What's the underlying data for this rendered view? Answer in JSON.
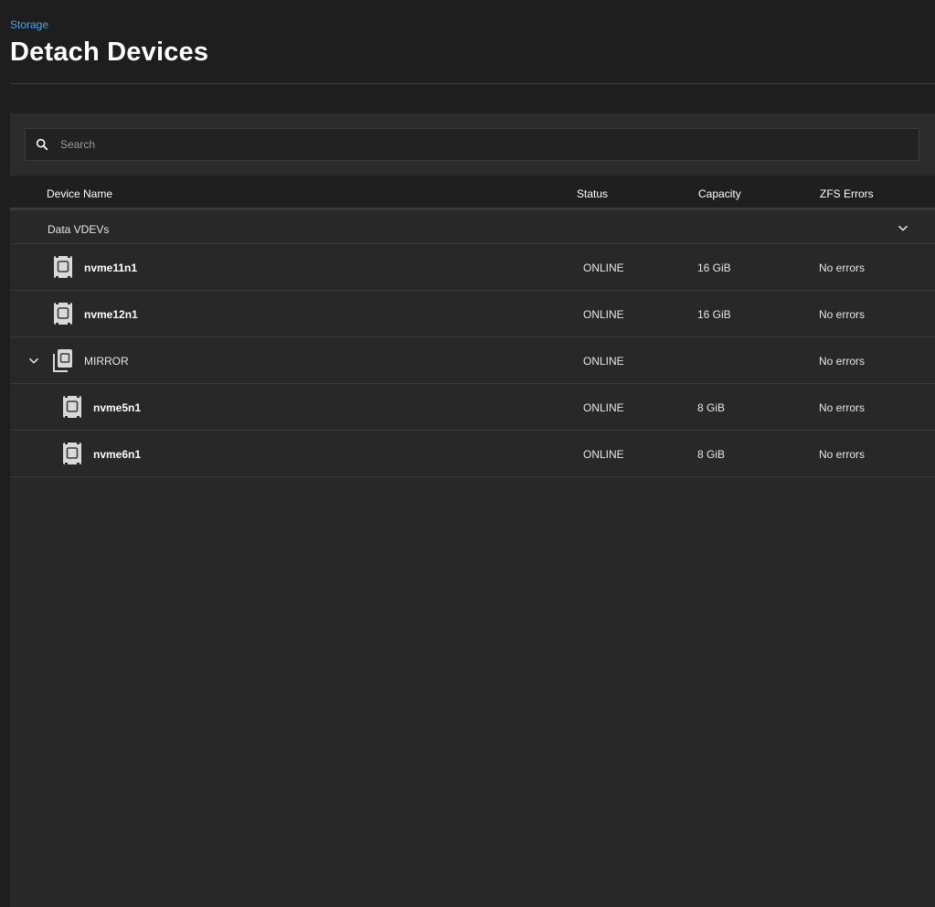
{
  "header": {
    "breadcrumb": "Storage",
    "title": "Detach Devices"
  },
  "search": {
    "placeholder": "Search",
    "value": ""
  },
  "table": {
    "columns": [
      "Device Name",
      "Status",
      "Capacity",
      "ZFS Errors"
    ],
    "group": {
      "label": "Data VDEVs",
      "expanded": true
    },
    "rows": [
      {
        "name": "nvme11n1",
        "status": "ONLINE",
        "capacity": "16 GiB",
        "errors": "No errors",
        "type": "disk"
      },
      {
        "name": "nvme12n1",
        "status": "ONLINE",
        "capacity": "16 GiB",
        "errors": "No errors",
        "type": "disk"
      },
      {
        "name": "MIRROR",
        "status": "ONLINE",
        "capacity": "",
        "errors": "No errors",
        "type": "mirror"
      },
      {
        "name": "nvme5n1",
        "status": "ONLINE",
        "capacity": "8 GiB",
        "errors": "No errors",
        "type": "disk"
      },
      {
        "name": "nvme6n1",
        "status": "ONLINE",
        "capacity": "8 GiB",
        "errors": "No errors",
        "type": "disk"
      }
    ]
  },
  "icons": {
    "search": "search-icon",
    "disk": "disk-icon",
    "mirror": "mirror-icon",
    "chevron": "chevron-down-icon"
  },
  "colors": {
    "accent": "#4fa3e0",
    "background": "#1e1e1e",
    "card": "#282828"
  }
}
